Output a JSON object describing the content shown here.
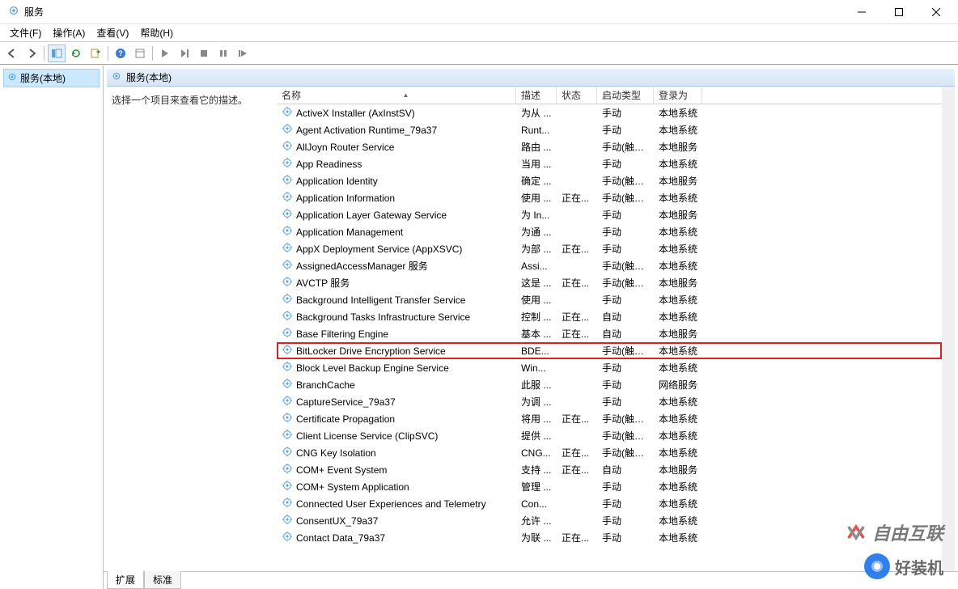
{
  "window": {
    "title": "服务"
  },
  "menus": {
    "file": "文件(F)",
    "action": "操作(A)",
    "view": "查看(V)",
    "help": "帮助(H)"
  },
  "tree": {
    "root": "服务(本地)"
  },
  "paneHeader": "服务(本地)",
  "descpane": "选择一个项目来查看它的描述。",
  "columns": {
    "name": "名称",
    "desc": "描述",
    "state": "状态",
    "startup": "启动类型",
    "logon": "登录为"
  },
  "tabs": {
    "extended": "扩展",
    "standard": "标准"
  },
  "watermarks": {
    "w1": "自由互联",
    "w2": "好装机"
  },
  "services": [
    {
      "name": "ActiveX Installer (AxInstSV)",
      "desc": "为从 ...",
      "state": "",
      "startup": "手动",
      "logon": "本地系统",
      "hi": false
    },
    {
      "name": "Agent Activation Runtime_79a37",
      "desc": "Runt...",
      "state": "",
      "startup": "手动",
      "logon": "本地系统",
      "hi": false
    },
    {
      "name": "AllJoyn Router Service",
      "desc": "路由 ...",
      "state": "",
      "startup": "手动(触发...",
      "logon": "本地服务",
      "hi": false
    },
    {
      "name": "App Readiness",
      "desc": "当用 ...",
      "state": "",
      "startup": "手动",
      "logon": "本地系统",
      "hi": false
    },
    {
      "name": "Application Identity",
      "desc": "确定 ...",
      "state": "",
      "startup": "手动(触发...",
      "logon": "本地服务",
      "hi": false
    },
    {
      "name": "Application Information",
      "desc": "使用 ...",
      "state": "正在...",
      "startup": "手动(触发...",
      "logon": "本地系统",
      "hi": false
    },
    {
      "name": "Application Layer Gateway Service",
      "desc": "为 In...",
      "state": "",
      "startup": "手动",
      "logon": "本地服务",
      "hi": false
    },
    {
      "name": "Application Management",
      "desc": "为通 ...",
      "state": "",
      "startup": "手动",
      "logon": "本地系统",
      "hi": false
    },
    {
      "name": "AppX Deployment Service (AppXSVC)",
      "desc": "为部 ...",
      "state": "正在...",
      "startup": "手动",
      "logon": "本地系统",
      "hi": false
    },
    {
      "name": "AssignedAccessManager 服务",
      "desc": "Assi...",
      "state": "",
      "startup": "手动(触发...",
      "logon": "本地系统",
      "hi": false
    },
    {
      "name": "AVCTP 服务",
      "desc": "这是 ...",
      "state": "正在...",
      "startup": "手动(触发...",
      "logon": "本地服务",
      "hi": false
    },
    {
      "name": "Background Intelligent Transfer Service",
      "desc": "使用 ...",
      "state": "",
      "startup": "手动",
      "logon": "本地系统",
      "hi": false
    },
    {
      "name": "Background Tasks Infrastructure Service",
      "desc": "控制 ...",
      "state": "正在...",
      "startup": "自动",
      "logon": "本地系统",
      "hi": false
    },
    {
      "name": "Base Filtering Engine",
      "desc": "基本 ...",
      "state": "正在...",
      "startup": "自动",
      "logon": "本地服务",
      "hi": false
    },
    {
      "name": "BitLocker Drive Encryption Service",
      "desc": "BDE...",
      "state": "",
      "startup": "手动(触发...",
      "logon": "本地系统",
      "hi": true
    },
    {
      "name": "Block Level Backup Engine Service",
      "desc": "Win...",
      "state": "",
      "startup": "手动",
      "logon": "本地系统",
      "hi": false
    },
    {
      "name": "BranchCache",
      "desc": "此服 ...",
      "state": "",
      "startup": "手动",
      "logon": "网络服务",
      "hi": false
    },
    {
      "name": "CaptureService_79a37",
      "desc": "为调 ...",
      "state": "",
      "startup": "手动",
      "logon": "本地系统",
      "hi": false
    },
    {
      "name": "Certificate Propagation",
      "desc": "将用 ...",
      "state": "正在...",
      "startup": "手动(触发...",
      "logon": "本地系统",
      "hi": false
    },
    {
      "name": "Client License Service (ClipSVC)",
      "desc": "提供 ...",
      "state": "",
      "startup": "手动(触发...",
      "logon": "本地系统",
      "hi": false
    },
    {
      "name": "CNG Key Isolation",
      "desc": "CNG...",
      "state": "正在...",
      "startup": "手动(触发...",
      "logon": "本地系统",
      "hi": false
    },
    {
      "name": "COM+ Event System",
      "desc": "支持 ...",
      "state": "正在...",
      "startup": "自动",
      "logon": "本地服务",
      "hi": false
    },
    {
      "name": "COM+ System Application",
      "desc": "管理 ...",
      "state": "",
      "startup": "手动",
      "logon": "本地系统",
      "hi": false
    },
    {
      "name": "Connected User Experiences and Telemetry",
      "desc": "Con...",
      "state": "",
      "startup": "手动",
      "logon": "本地系统",
      "hi": false
    },
    {
      "name": "ConsentUX_79a37",
      "desc": "允许 ...",
      "state": "",
      "startup": "手动",
      "logon": "本地系统",
      "hi": false
    },
    {
      "name": "Contact Data_79a37",
      "desc": "为联 ...",
      "state": "正在...",
      "startup": "手动",
      "logon": "本地系统",
      "hi": false
    }
  ]
}
